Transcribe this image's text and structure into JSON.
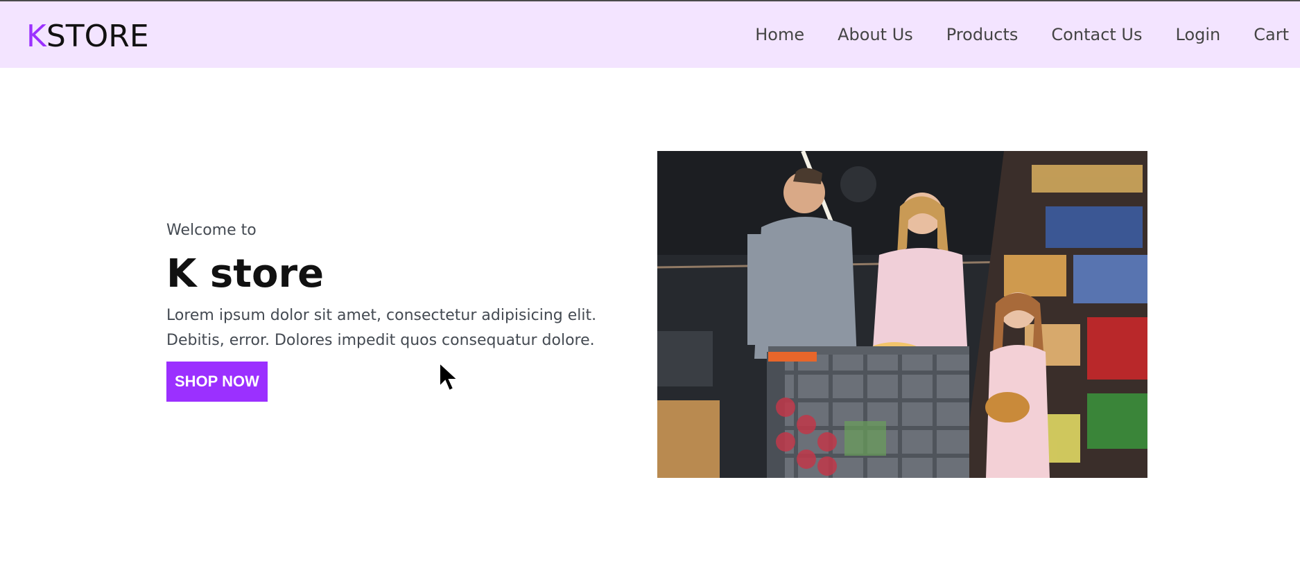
{
  "header": {
    "logo_accent": "K",
    "logo_rest": "STORE",
    "nav": [
      "Home",
      "About Us",
      "Products",
      "Contact Us",
      "Login",
      "Cart"
    ]
  },
  "hero": {
    "welcome": "Welcome to",
    "title": "K store",
    "description": "Lorem ipsum dolor sit amet, consectetur adipisicing elit. Debitis, error. Dolores impedit quos consequatur dolore.",
    "button_label": "SHOP NOW"
  },
  "colors": {
    "accent": "#9b30ff",
    "header_bg": "#f3e4ff"
  },
  "icons": {
    "cursor": "mouse-pointer-icon"
  }
}
